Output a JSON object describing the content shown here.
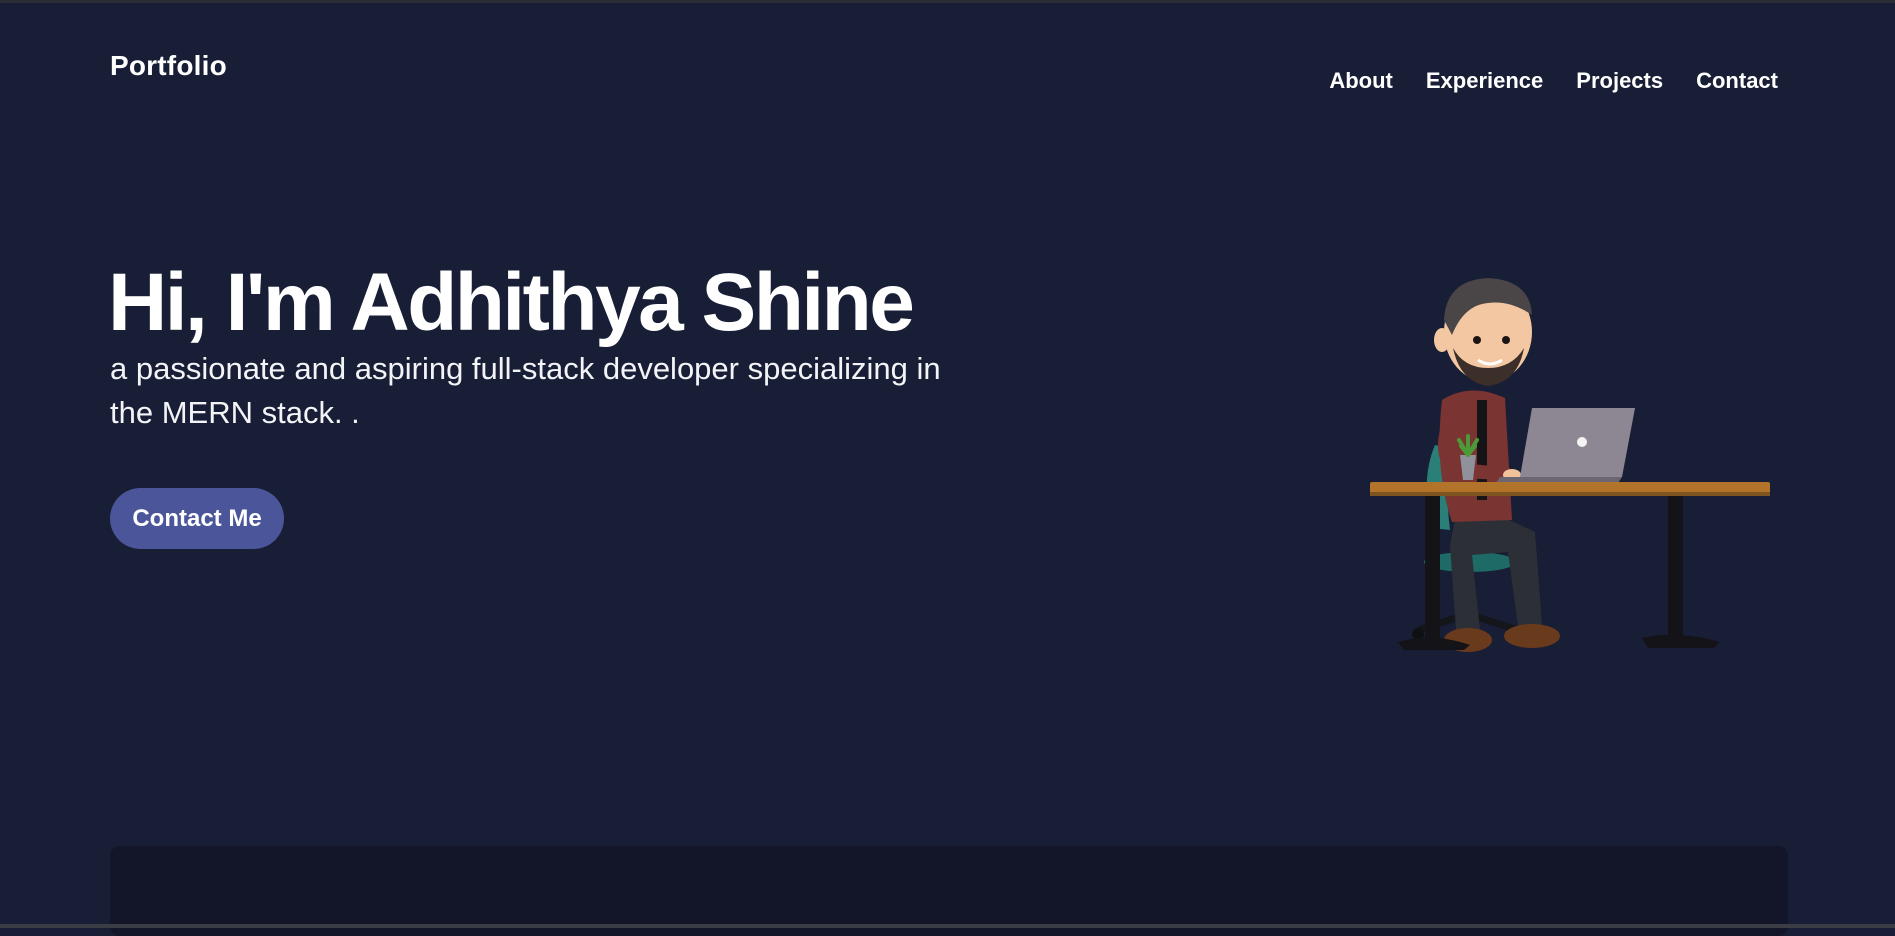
{
  "header": {
    "brand": "Portfolio",
    "nav": [
      {
        "label": "About"
      },
      {
        "label": "Experience"
      },
      {
        "label": "Projects"
      },
      {
        "label": "Contact"
      }
    ]
  },
  "hero": {
    "title": "Hi, I'm Adhithya Shine",
    "subtitle": "a passionate and aspiring full-stack developer specializing in the MERN stack. .",
    "cta_label": "Contact Me",
    "illustration_icon": "developer-at-desk-illustration"
  },
  "colors": {
    "background": "#181e35",
    "button": "#4a5699",
    "card": "#121628"
  }
}
